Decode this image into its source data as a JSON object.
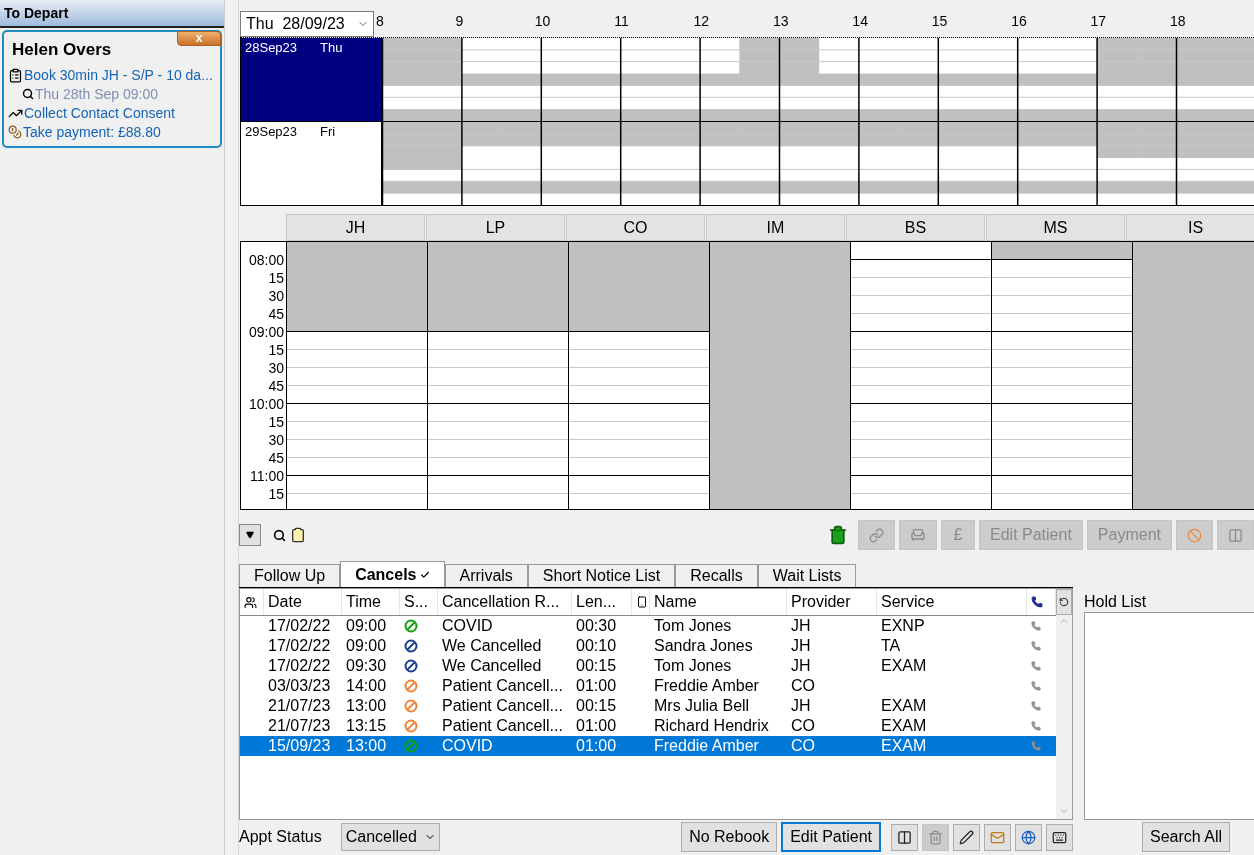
{
  "sidebar": {
    "title": "To Depart",
    "card": {
      "name": "Helen Overs",
      "close_label": "x",
      "items": [
        {
          "kind": "task",
          "text": "Book 30min JH - S/P - 10 da..."
        },
        {
          "kind": "search",
          "text": "Thu 28th Sep 09:00"
        },
        {
          "kind": "chart",
          "text": "Collect Contact Consent"
        },
        {
          "kind": "payment",
          "text": "Take payment: £88.80"
        }
      ]
    }
  },
  "day_view": {
    "date_select": "Thu  28/09/23",
    "hours": [
      "8",
      "9",
      "10",
      "11",
      "12",
      "13",
      "14",
      "15",
      "16",
      "17",
      "18"
    ],
    "days": [
      {
        "date": "28Sep23",
        "weekday": "Thu",
        "selected": true
      },
      {
        "date": "29Sep23",
        "weekday": "Fri",
        "selected": false
      }
    ]
  },
  "schedule": {
    "providers": [
      {
        "code": "JH",
        "kind": "late-start"
      },
      {
        "code": "LP",
        "kind": "late-start"
      },
      {
        "code": "CO",
        "kind": "late-start"
      },
      {
        "code": "IM",
        "kind": "closed"
      },
      {
        "code": "BS",
        "kind": "open"
      },
      {
        "code": "MS",
        "kind": "first-slot-off"
      },
      {
        "code": "IS",
        "kind": "closed"
      }
    ],
    "times": [
      "08:00",
      "15",
      "30",
      "45",
      "09:00",
      "15",
      "30",
      "45",
      "10:00",
      "15",
      "30",
      "45",
      "11:00",
      "15"
    ]
  },
  "toolbar": {
    "buttons": [
      {
        "kind": "link",
        "disabled": true
      },
      {
        "kind": "chair",
        "disabled": true
      },
      {
        "kind": "text",
        "label": "£",
        "disabled": true
      },
      {
        "kind": "text",
        "label": "Edit Patient",
        "disabled": true
      },
      {
        "kind": "text",
        "label": "Payment",
        "disabled": true
      },
      {
        "kind": "cancel",
        "disabled": true
      },
      {
        "kind": "split",
        "disabled": true
      }
    ]
  },
  "tabs": [
    {
      "label": "Follow Up",
      "selected": false
    },
    {
      "label": "Cancels",
      "selected": true
    },
    {
      "label": "Arrivals",
      "selected": false
    },
    {
      "label": "Short Notice List",
      "selected": false
    },
    {
      "label": "Recalls",
      "selected": false
    },
    {
      "label": "Wait Lists",
      "selected": false
    }
  ],
  "table": {
    "columns": [
      {
        "kind": "icon"
      },
      {
        "kind": "text",
        "label": "Date"
      },
      {
        "kind": "text",
        "label": "Time"
      },
      {
        "kind": "text",
        "label": "S..."
      },
      {
        "kind": "text",
        "label": "Cancellation R..."
      },
      {
        "kind": "text",
        "label": "Len..."
      },
      {
        "kind": "icon"
      },
      {
        "kind": "text",
        "label": "Name"
      },
      {
        "kind": "text",
        "label": "Provider"
      },
      {
        "kind": "text",
        "label": "Service"
      },
      {
        "kind": "icon"
      }
    ],
    "rows": [
      {
        "date": "17/02/22",
        "time": "09:00",
        "color": "#13a013",
        "reason": "COVID",
        "length": "00:30",
        "name": "Tom Jones",
        "provider": "JH",
        "service": "EXNP",
        "selected": false
      },
      {
        "date": "17/02/22",
        "time": "09:00",
        "color": "#1b3f94",
        "reason": "We Cancelled",
        "length": "00:10",
        "name": "Sandra Jones",
        "provider": "JH",
        "service": "TA",
        "selected": false
      },
      {
        "date": "17/02/22",
        "time": "09:30",
        "color": "#1b3f94",
        "reason": "We Cancelled",
        "length": "00:15",
        "name": "Tom Jones",
        "provider": "JH",
        "service": "EXAM",
        "selected": false
      },
      {
        "date": "03/03/23",
        "time": "14:00",
        "color": "#f0853a",
        "reason": "Patient Cancell...",
        "length": "01:00",
        "name": "Freddie Amber",
        "provider": "CO",
        "service": "",
        "selected": false
      },
      {
        "date": "21/07/23",
        "time": "13:00",
        "color": "#f0853a",
        "reason": "Patient Cancell...",
        "length": "00:15",
        "name": "Mrs Julia Bell",
        "provider": "JH",
        "service": "EXAM",
        "selected": false
      },
      {
        "date": "21/07/23",
        "time": "13:15",
        "color": "#f0853a",
        "reason": "Patient Cancell...",
        "length": "01:00",
        "name": "Richard Hendrix",
        "provider": "CO",
        "service": "EXAM",
        "selected": false
      },
      {
        "date": "15/09/23",
        "time": "13:00",
        "color": "#13a013",
        "reason": "COVID",
        "length": "01:00",
        "name": "Freddie Amber",
        "provider": "CO",
        "service": "EXAM",
        "selected": true
      }
    ]
  },
  "footer": {
    "status_label": "Appt Status",
    "status_value": "Cancelled",
    "buttons": [
      {
        "label": "No Rebook",
        "focused": false
      },
      {
        "label": "Edit Patient",
        "focused": true
      }
    ],
    "icon_buttons": [
      {
        "kind": "split",
        "disabled": false
      },
      {
        "kind": "trash",
        "disabled": true
      },
      {
        "kind": "pen",
        "disabled": false
      },
      {
        "kind": "envelope",
        "disabled": false
      },
      {
        "kind": "globe",
        "disabled": false
      },
      {
        "kind": "keyboard",
        "disabled": false
      }
    ]
  },
  "hold_list": {
    "title": "Hold List",
    "button": "Search All"
  }
}
